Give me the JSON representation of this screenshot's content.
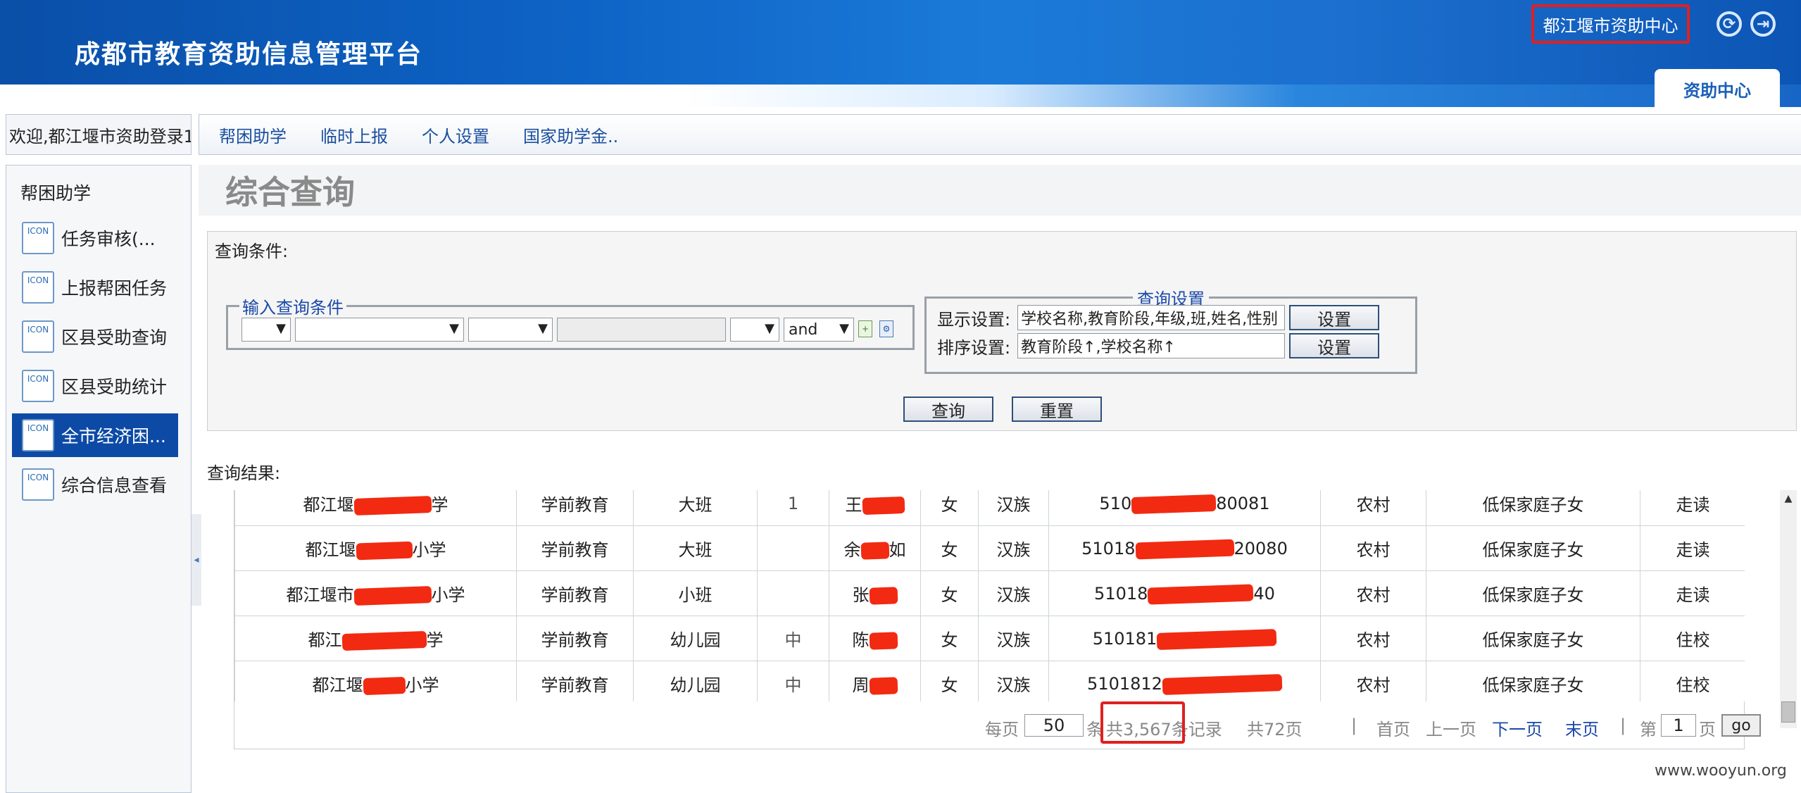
{
  "header": {
    "title": "成都市教育资助信息管理平台",
    "center_button": "都江堰市资助中心",
    "refresh_icon": "refresh-icon",
    "logout_icon": "logout-icon",
    "active_tab": "资助中心"
  },
  "welcome": "欢迎,都江堰市资助登录1",
  "nav": [
    "帮困助学",
    "临时上报",
    "个人设置",
    "国家助学金.."
  ],
  "sidebar": {
    "heading": "帮困助学",
    "icon_label": "ICON",
    "items": [
      "任务审核(...",
      "上报帮困任务",
      "区县受助查询",
      "区县受助统计",
      "全市经济困...",
      "综合信息查看"
    ],
    "active_index": 4
  },
  "page_title": "综合查询",
  "query": {
    "label": "查询条件:",
    "condition_legend": "输入查询条件",
    "logic_value": "and",
    "settings_legend": "查询设置",
    "display_label": "显示设置:",
    "display_value": "学校名称,教育阶段,年级,班,姓名,性别",
    "sort_label": "排序设置:",
    "sort_value": "教育阶段↑,学校名称↑",
    "set_button": "设置",
    "query_button": "查询",
    "reset_button": "重置"
  },
  "results": {
    "label": "查询结果:",
    "rows": [
      {
        "school_a": "都江堰",
        "school_b": "学",
        "stage": "学前教育",
        "grade": "大班",
        "class": "1",
        "name_a": "王",
        "name_b": "",
        "gender": "女",
        "ethnic": "汉族",
        "id_a": "510",
        "id_b": "80081",
        "area": "农村",
        "type": "低保家庭子女",
        "boarding": "走读"
      },
      {
        "school_a": "都江堰",
        "school_b": "小学",
        "stage": "学前教育",
        "grade": "大班",
        "class": "",
        "name_a": "余",
        "name_b": "如",
        "gender": "女",
        "ethnic": "汉族",
        "id_a": "51018",
        "id_b": "20080",
        "area": "农村",
        "type": "低保家庭子女",
        "boarding": "走读"
      },
      {
        "school_a": "都江堰市",
        "school_b": "小学",
        "stage": "学前教育",
        "grade": "小班",
        "class": "",
        "name_a": "张",
        "name_b": "",
        "gender": "女",
        "ethnic": "汉族",
        "id_a": "51018",
        "id_b": "40",
        "area": "农村",
        "type": "低保家庭子女",
        "boarding": "走读"
      },
      {
        "school_a": "都江",
        "school_b": "学",
        "stage": "学前教育",
        "grade": "幼儿园",
        "class": "中",
        "name_a": "陈",
        "name_b": "",
        "gender": "女",
        "ethnic": "汉族",
        "id_a": "510181",
        "id_b": "",
        "area": "农村",
        "type": "低保家庭子女",
        "boarding": "住校"
      },
      {
        "school_a": "都江堰",
        "school_b": "小学",
        "stage": "学前教育",
        "grade": "幼儿园",
        "class": "中",
        "name_a": "周",
        "name_b": "",
        "gender": "女",
        "ethnic": "汉族",
        "id_a": "5101812",
        "id_b": "",
        "area": "农村",
        "type": "低保家庭子女",
        "boarding": "住校"
      }
    ]
  },
  "pager": {
    "per_page_label": "每页",
    "per_page_value": "50",
    "unit_item": "条",
    "total_records": "共3,567条记录",
    "total_pages": "共72页",
    "first": "首页",
    "prev": "上一页",
    "next": "下一页",
    "last": "末页",
    "page_prefix": "第",
    "page_value": "1",
    "page_suffix": "页",
    "go": "go"
  },
  "watermark": "www.wooyun.org",
  "colors": {
    "header_blue": "#0d62c4",
    "active_blue": "#0c4aa6",
    "highlight_red": "#e02020",
    "redaction_red": "#f22a12",
    "link_blue": "#1a49a8"
  }
}
